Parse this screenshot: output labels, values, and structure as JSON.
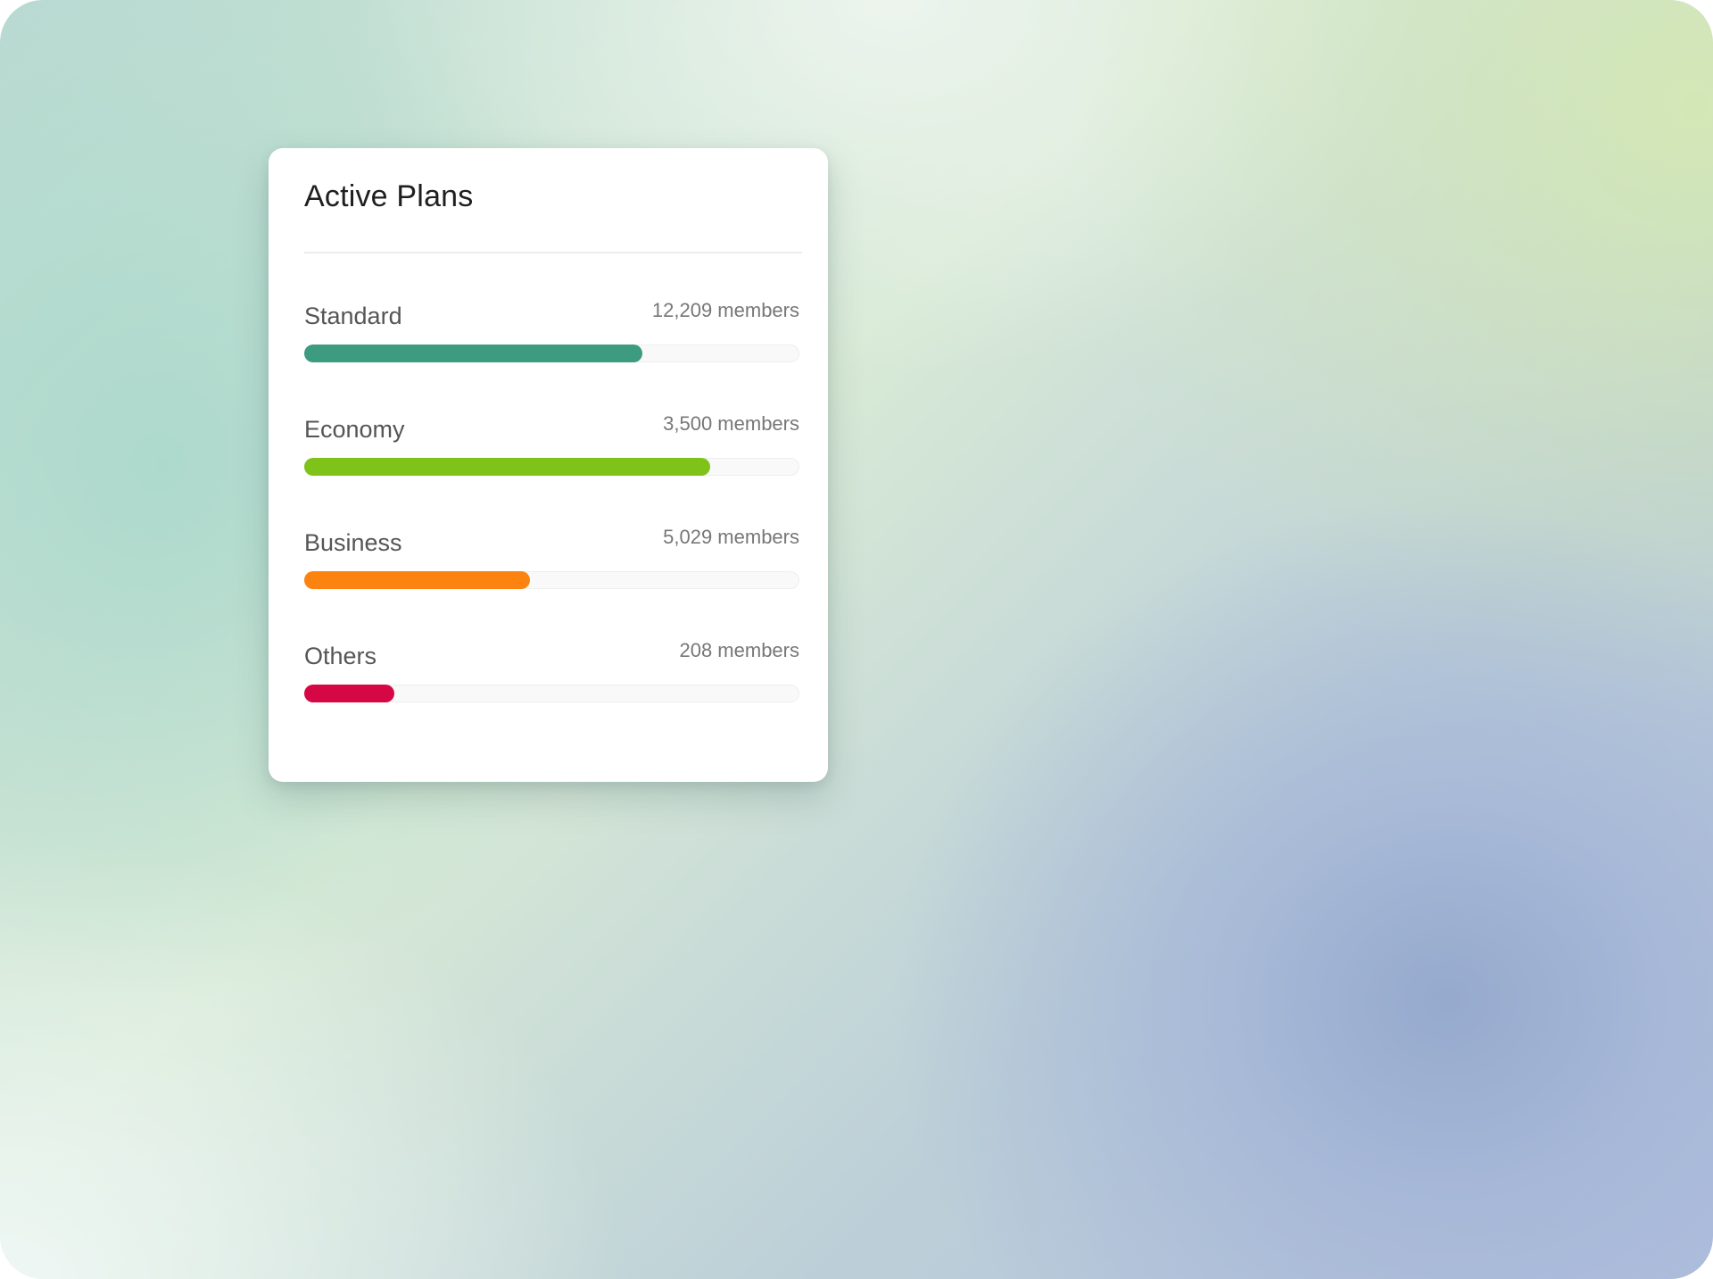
{
  "card": {
    "title": "Active Plans"
  },
  "plans": [
    {
      "name": "Standard",
      "members": "12,209 members",
      "progress": 0.685,
      "color": "#3d9b80"
    },
    {
      "name": "Economy",
      "members": "3,500 members",
      "progress": 0.822,
      "color": "#7ec21a"
    },
    {
      "name": "Business",
      "members": "5,029 members",
      "progress": 0.457,
      "color": "#fc830f"
    },
    {
      "name": "Others",
      "members": "208 members",
      "progress": 0.183,
      "color": "#d50745"
    }
  ]
}
